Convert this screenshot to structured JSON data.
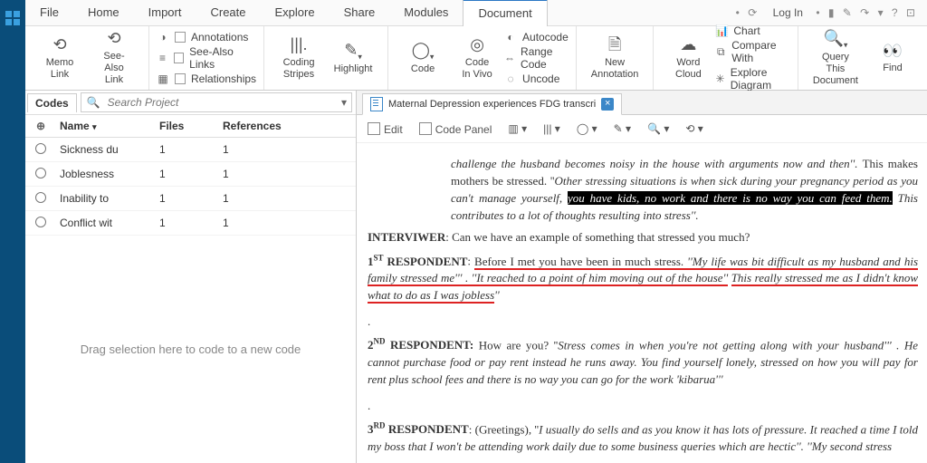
{
  "menu": {
    "items": [
      "File",
      "Home",
      "Import",
      "Create",
      "Explore",
      "Share",
      "Modules",
      "Document"
    ],
    "active": 7,
    "login": "Log In"
  },
  "ribbon": {
    "memo": "Memo\nLink",
    "seealso": "See-Also\nLink",
    "annots": "Annotations",
    "seelinks": "See-Also Links",
    "rels": "Relationships",
    "stripes": "Coding\nStripes",
    "highlight": "Highlight",
    "code": "Code",
    "vivo": "Code\nIn Vivo",
    "autocode": "Autocode",
    "rangecode": "Range Code",
    "uncode": "Uncode",
    "newannot": "New\nAnnotation",
    "wordcloud": "Word\nCloud",
    "chart": "Chart",
    "compare": "Compare With",
    "explore": "Explore Diagram",
    "query": "Query This\nDocument",
    "find": "Find"
  },
  "sidebar": {
    "title": "Codes",
    "search_ph": "Search Project",
    "cols": {
      "name": "Name",
      "files": "Files",
      "refs": "References"
    },
    "rows": [
      {
        "name": "Sickness du",
        "files": "1",
        "refs": "1"
      },
      {
        "name": "Joblesness",
        "files": "1",
        "refs": "1"
      },
      {
        "name": "Inability to",
        "files": "1",
        "refs": "1"
      },
      {
        "name": "Conflict wit",
        "files": "1",
        "refs": "1"
      }
    ],
    "hint": "Drag selection here to code to a new code"
  },
  "doc": {
    "tab": "Maternal Depression experiences FDG transcri",
    "toolbar": {
      "edit": "Edit",
      "codepanel": "Code Panel"
    },
    "p1a": "challenge the husband becomes noisy in the house with arguments now and then''. ",
    "p1b": "This makes mothers be stressed. ''",
    "p1c": "Other stressing situations is when sick during your pregnancy period as you can't manage yourself, ",
    "p1d": "you have kids, no work and there is no way you can feed them.",
    "p1e": " This contributes to a lot of thoughts resulting into stress''.",
    "int": "INTERVIWER",
    "intq": ": Can we have an example of something that stressed you much?",
    "r1": "RESPONDENT",
    "r1a": "Before I met you have been in much stress.",
    "r1b": " ''My life was bit difficult as my husband and his family",
    "r1c": " stressed me''' . ''It reached to a point of him moving out of the house''",
    "r1d": "This really stressed me as I didn't know what to do as I was jobless",
    "r2": "RESPONDENT:",
    "r2a": " How are you? ''",
    "r2b": "Stress comes in when you're not getting along with your husband''' . He cannot purchase food or pay rent instead he runs away. You find yourself lonely, stressed on how you will pay for rent plus school fees and there is no way you can go for the work 'kibarua'''",
    "r3": "RESPONDENT",
    "r3a": ": (Greetings), ''",
    "r3b": "I usually do sells and as you know it has lots of pressure. It reached a time I told my boss that I won't be attending work daily due to some business queries which are hectic''. ''My second stress"
  }
}
